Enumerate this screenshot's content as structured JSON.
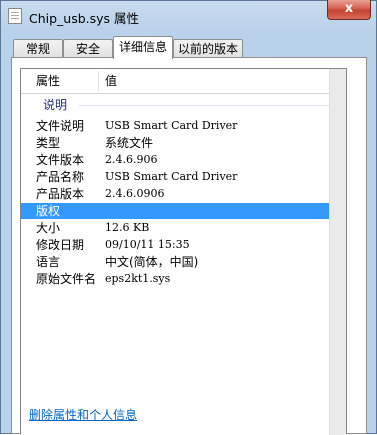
{
  "window": {
    "title": "Chip_usb.sys 属性",
    "close_glyph": "x"
  },
  "tabs": [
    {
      "label": "常规",
      "active": false
    },
    {
      "label": "安全",
      "active": false
    },
    {
      "label": "详细信息",
      "active": true
    },
    {
      "label": "以前的版本",
      "active": false
    }
  ],
  "list": {
    "header": {
      "property": "属性",
      "value": "值"
    },
    "group": "说明",
    "rows": [
      {
        "key": "文件说明",
        "value": "USB Smart Card Driver"
      },
      {
        "key": "类型",
        "value": "系统文件"
      },
      {
        "key": "文件版本",
        "value": "2.4.6.906"
      },
      {
        "key": "产品名称",
        "value": "USB Smart Card Driver"
      },
      {
        "key": "产品版本",
        "value": "2.4.6.0906"
      },
      {
        "key": "版权",
        "value": ""
      },
      {
        "key": "大小",
        "value": "12.6 KB"
      },
      {
        "key": "修改日期",
        "value": "09/10/11 15:35"
      },
      {
        "key": "语言",
        "value": "中文(简体，中国)"
      },
      {
        "key": "原始文件名",
        "value": "eps2kt1.sys"
      }
    ],
    "selected_row_index": 5
  },
  "footer": {
    "remove_link": "删除属性和个人信息"
  },
  "colors": {
    "selection": "#3399ff",
    "link": "#0066cc",
    "group_header": "#1e3287"
  }
}
